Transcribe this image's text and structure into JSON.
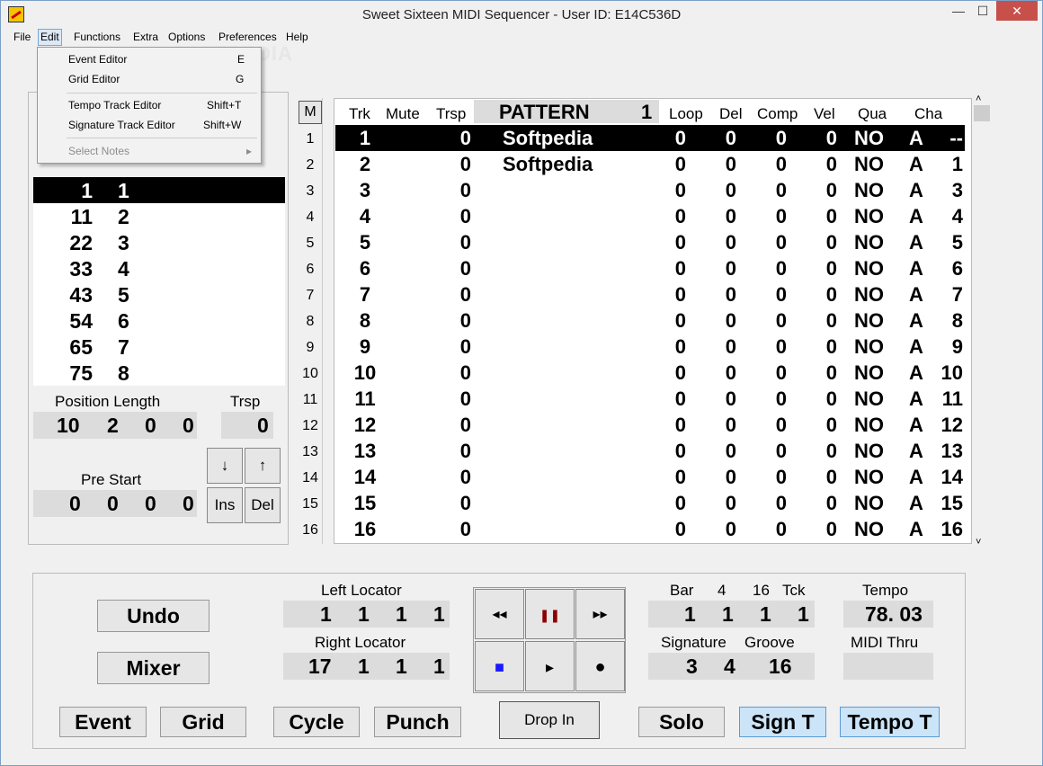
{
  "window": {
    "title": "Sweet Sixteen MIDI Sequencer - User ID: E14C536D",
    "min": "—",
    "max": "☐",
    "close": "✕"
  },
  "watermark": "SOFTPEDIA",
  "menu": [
    "File",
    "Edit",
    "Functions",
    "Extra",
    "Options",
    "Preferences",
    "Help"
  ],
  "edit_menu": {
    "items": [
      {
        "label": "Event Editor",
        "key": "E"
      },
      {
        "label": "Grid Editor",
        "key": "G"
      },
      {
        "label": "Tempo Track Editor",
        "key": "Shift+T"
      },
      {
        "label": "Signature Track Editor",
        "key": "Shift+W"
      },
      {
        "label": "Select Notes",
        "key": "▸"
      }
    ]
  },
  "left_list": [
    [
      "1",
      "1"
    ],
    [
      "11",
      "2"
    ],
    [
      "22",
      "3"
    ],
    [
      "33",
      "4"
    ],
    [
      "43",
      "5"
    ],
    [
      "54",
      "6"
    ],
    [
      "65",
      "7"
    ],
    [
      "75",
      "8"
    ]
  ],
  "left_panel": {
    "position_length_label": "Position Length",
    "trsp_label": "Trsp",
    "position_values": [
      "10",
      "2",
      "0",
      "0"
    ],
    "trsp_value": "0",
    "pre_start_label": "Pre Start",
    "pre_start_values": [
      "0",
      "0",
      "0",
      "0"
    ],
    "down_btn": "↓",
    "up_btn": "↑",
    "ins_btn": "Ins",
    "del_btn": "Del"
  },
  "m_button": "M",
  "row_numbers": [
    "1",
    "2",
    "3",
    "4",
    "5",
    "6",
    "7",
    "8",
    "9",
    "10",
    "11",
    "12",
    "13",
    "14",
    "15",
    "16"
  ],
  "track_headers": {
    "trk": "Trk",
    "mute": "Mute",
    "trsp": "Trsp",
    "pattern": "PATTERN",
    "pattern_num": "1",
    "loop": "Loop",
    "del": "Del",
    "comp": "Comp",
    "vel": "Vel",
    "qua": "Qua",
    "cha": "Cha"
  },
  "tracks": [
    {
      "trk": "1",
      "trsp": "0",
      "pattern": "Softpedia",
      "loop": "0",
      "del": "0",
      "comp": "0",
      "vel": "0",
      "qua": "NO",
      "a": "A",
      "cha": "--"
    },
    {
      "trk": "2",
      "trsp": "0",
      "pattern": "Softpedia",
      "loop": "0",
      "del": "0",
      "comp": "0",
      "vel": "0",
      "qua": "NO",
      "a": "A",
      "cha": "1"
    },
    {
      "trk": "3",
      "trsp": "0",
      "pattern": "",
      "loop": "0",
      "del": "0",
      "comp": "0",
      "vel": "0",
      "qua": "NO",
      "a": "A",
      "cha": "3"
    },
    {
      "trk": "4",
      "trsp": "0",
      "pattern": "",
      "loop": "0",
      "del": "0",
      "comp": "0",
      "vel": "0",
      "qua": "NO",
      "a": "A",
      "cha": "4"
    },
    {
      "trk": "5",
      "trsp": "0",
      "pattern": "",
      "loop": "0",
      "del": "0",
      "comp": "0",
      "vel": "0",
      "qua": "NO",
      "a": "A",
      "cha": "5"
    },
    {
      "trk": "6",
      "trsp": "0",
      "pattern": "",
      "loop": "0",
      "del": "0",
      "comp": "0",
      "vel": "0",
      "qua": "NO",
      "a": "A",
      "cha": "6"
    },
    {
      "trk": "7",
      "trsp": "0",
      "pattern": "",
      "loop": "0",
      "del": "0",
      "comp": "0",
      "vel": "0",
      "qua": "NO",
      "a": "A",
      "cha": "7"
    },
    {
      "trk": "8",
      "trsp": "0",
      "pattern": "",
      "loop": "0",
      "del": "0",
      "comp": "0",
      "vel": "0",
      "qua": "NO",
      "a": "A",
      "cha": "8"
    },
    {
      "trk": "9",
      "trsp": "0",
      "pattern": "",
      "loop": "0",
      "del": "0",
      "comp": "0",
      "vel": "0",
      "qua": "NO",
      "a": "A",
      "cha": "9"
    },
    {
      "trk": "10",
      "trsp": "0",
      "pattern": "",
      "loop": "0",
      "del": "0",
      "comp": "0",
      "vel": "0",
      "qua": "NO",
      "a": "A",
      "cha": "10"
    },
    {
      "trk": "11",
      "trsp": "0",
      "pattern": "",
      "loop": "0",
      "del": "0",
      "comp": "0",
      "vel": "0",
      "qua": "NO",
      "a": "A",
      "cha": "11"
    },
    {
      "trk": "12",
      "trsp": "0",
      "pattern": "",
      "loop": "0",
      "del": "0",
      "comp": "0",
      "vel": "0",
      "qua": "NO",
      "a": "A",
      "cha": "12"
    },
    {
      "trk": "13",
      "trsp": "0",
      "pattern": "",
      "loop": "0",
      "del": "0",
      "comp": "0",
      "vel": "0",
      "qua": "NO",
      "a": "A",
      "cha": "13"
    },
    {
      "trk": "14",
      "trsp": "0",
      "pattern": "",
      "loop": "0",
      "del": "0",
      "comp": "0",
      "vel": "0",
      "qua": "NO",
      "a": "A",
      "cha": "14"
    },
    {
      "trk": "15",
      "trsp": "0",
      "pattern": "",
      "loop": "0",
      "del": "0",
      "comp": "0",
      "vel": "0",
      "qua": "NO",
      "a": "A",
      "cha": "15"
    },
    {
      "trk": "16",
      "trsp": "0",
      "pattern": "",
      "loop": "0",
      "del": "0",
      "comp": "0",
      "vel": "0",
      "qua": "NO",
      "a": "A",
      "cha": "16"
    }
  ],
  "bottom": {
    "undo": "Undo",
    "mixer": "Mixer",
    "left_locator_label": "Left Locator",
    "left_locator": [
      "1",
      "1",
      "1",
      "1"
    ],
    "right_locator_label": "Right Locator",
    "right_locator": [
      "17",
      "1",
      "1",
      "1"
    ],
    "transport": {
      "rewind": "◂◂",
      "pause": "❚❚",
      "ffwd": "▸▸",
      "stop": "■",
      "play": "▸",
      "record": "●"
    },
    "bar_labels": [
      "Bar",
      "4",
      "16",
      "Tck"
    ],
    "bar_values": [
      "1",
      "1",
      "1",
      "1"
    ],
    "tempo_label": "Tempo",
    "tempo_value": "78. 03",
    "signature_label": "Signature",
    "groove_label": "Groove",
    "signature_values": [
      "3",
      "4"
    ],
    "groove_value": "16",
    "midi_thru_label": "MIDI Thru",
    "event": "Event",
    "grid": "Grid",
    "cycle": "Cycle",
    "punch": "Punch",
    "drop_in": "Drop In",
    "solo": "Solo",
    "sign_t": "Sign T",
    "tempo_t": "Tempo T"
  },
  "colors": {
    "selected_row": "#000000",
    "pause_icon": "#8b0000",
    "stop_icon": "#1a1aff",
    "toggle_blue": "#cce4f7"
  }
}
